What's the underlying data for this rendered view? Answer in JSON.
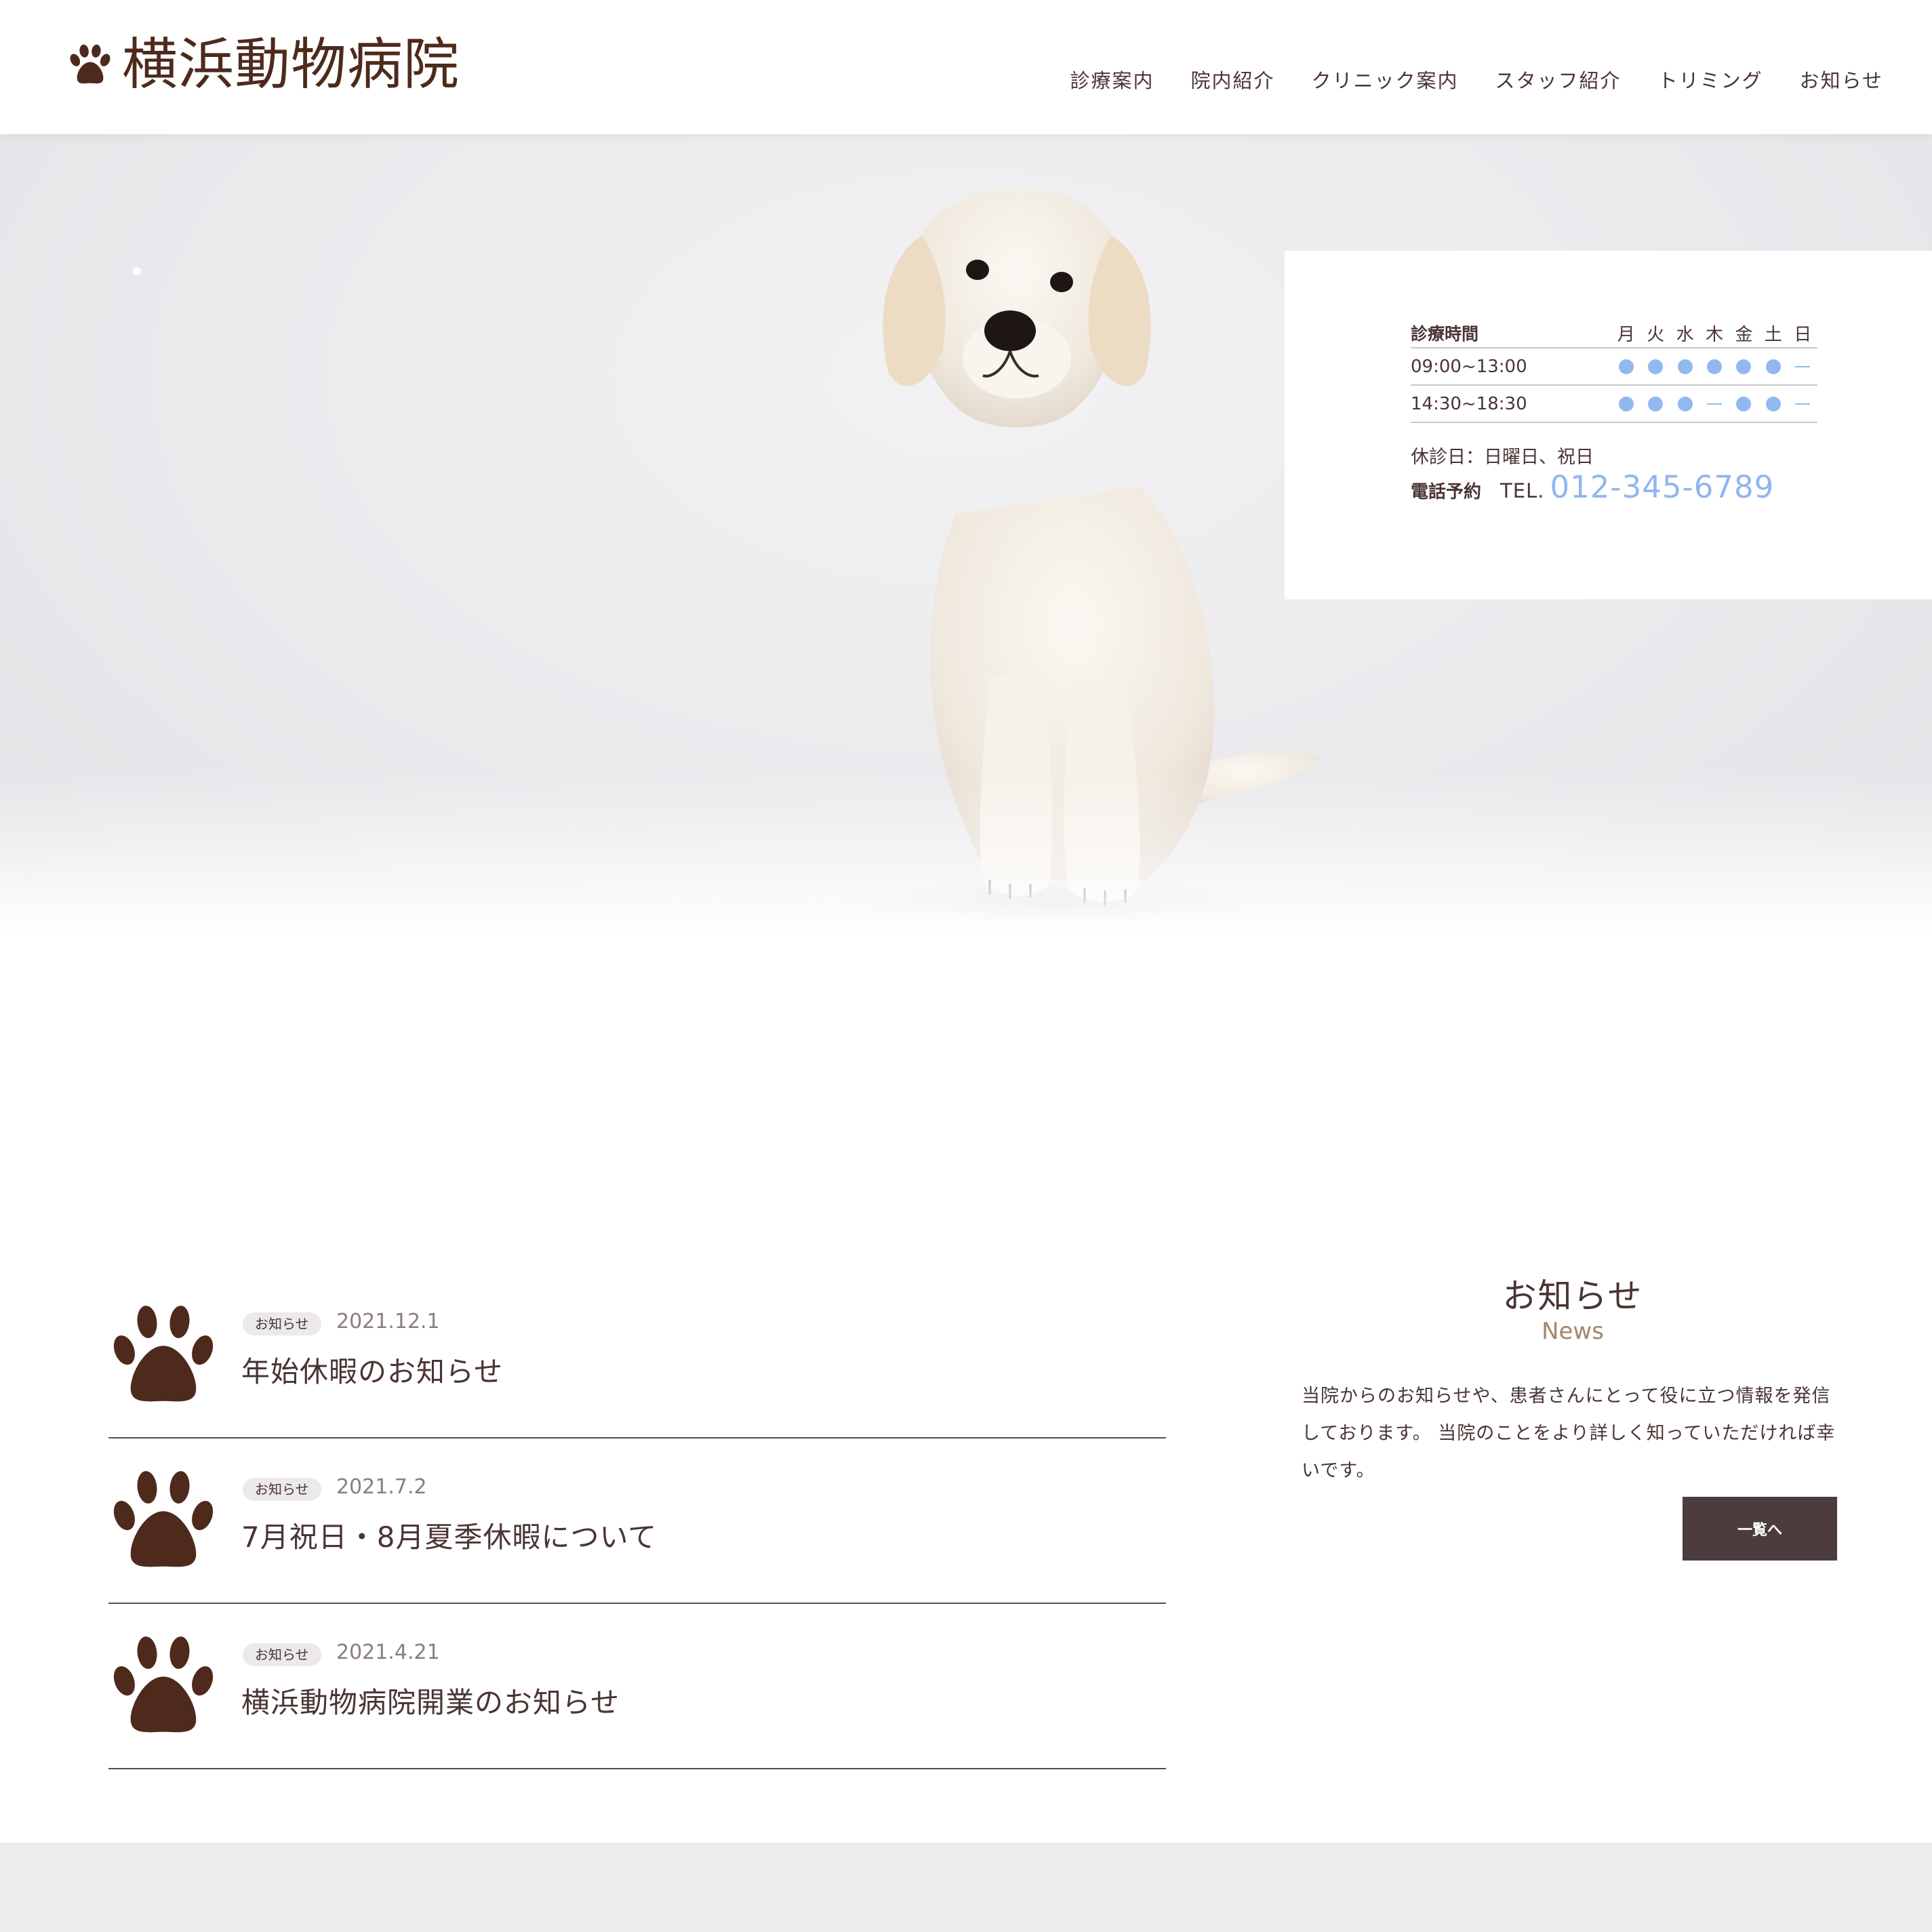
{
  "header": {
    "logo_text": "横浜動物病院",
    "nav": [
      "診療案内",
      "院内紹介",
      "クリニック案内",
      "スタッフ紹介",
      "トリミング",
      "お知らせ"
    ]
  },
  "hours": {
    "header_label": "診療時間",
    "days": [
      "月",
      "火",
      "水",
      "木",
      "金",
      "土",
      "日"
    ],
    "rows": [
      {
        "time": "09:00~13:00",
        "status": [
          "open",
          "open",
          "open",
          "open",
          "open",
          "open",
          "closed"
        ]
      },
      {
        "time": "14:30~18:30",
        "status": [
          "open",
          "open",
          "open",
          "closed",
          "open",
          "open",
          "closed"
        ]
      }
    ],
    "holiday_note": "休診日：日曜日、祝日",
    "tel_label": "電話予約",
    "tel_prefix": "TEL.",
    "tel_number": "012-345-6789"
  },
  "news": {
    "heading": "お知らせ",
    "subheading": "News",
    "description": "当院からのお知らせや、患者さんにとって役に立つ情報を発信しております。 当院のことをより詳しく知っていただければ幸いです。",
    "button_label": "一覧へ",
    "items": [
      {
        "tag": "お知らせ",
        "date": "2021.12.1",
        "title": "年始休暇のお知らせ"
      },
      {
        "tag": "お知らせ",
        "date": "2021.7.2",
        "title": "7月祝日・8月夏季休暇について"
      },
      {
        "tag": "お知らせ",
        "date": "2021.4.21",
        "title": "横浜動物病院開業のお知らせ"
      }
    ]
  },
  "colors": {
    "brand_brown": "#4e2a1c",
    "accent_blue": "#92b9ef",
    "text": "#4a3434",
    "button_bg": "#4d3c3d",
    "news_sub": "#a18868"
  },
  "icons": {
    "logo": "paw-icon",
    "news_item": "paw-icon",
    "open": "circle",
    "closed": "dash"
  }
}
